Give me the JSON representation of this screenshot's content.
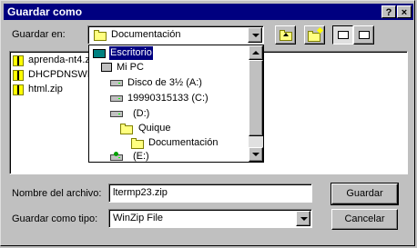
{
  "window": {
    "title": "Guardar como",
    "help_label": "?",
    "close_label": "×"
  },
  "save_in": {
    "label": "Guardar en:",
    "value": "Documentación"
  },
  "files": [
    {
      "name": "aprenda-nt4.zi"
    },
    {
      "name": "DHCPDNSWII"
    },
    {
      "name": "html.zip"
    }
  ],
  "dropdown": {
    "items": [
      {
        "label": "Escritorio",
        "icon": "desktop-icon",
        "selected": true
      },
      {
        "label": "Mi PC",
        "icon": "computer-icon"
      },
      {
        "label": "Disco de 3½ (A:)",
        "icon": "floppy-drive-icon"
      },
      {
        "label": "19990315133 (C:)",
        "icon": "hard-drive-icon"
      },
      {
        "label": "(D:)",
        "icon": "hard-drive-icon"
      },
      {
        "label": "Quique",
        "icon": "folder-icon"
      },
      {
        "label": "Documentación",
        "icon": "folder-open-icon"
      },
      {
        "label": "(E:)",
        "icon": "network-drive-icon"
      }
    ]
  },
  "filename": {
    "label": "Nombre del archivo:",
    "value": "ltermp23.zip"
  },
  "filetype": {
    "label": "Guardar como tipo:",
    "value": "WinZip File"
  },
  "buttons": {
    "save": "Guardar",
    "cancel": "Cancelar"
  }
}
